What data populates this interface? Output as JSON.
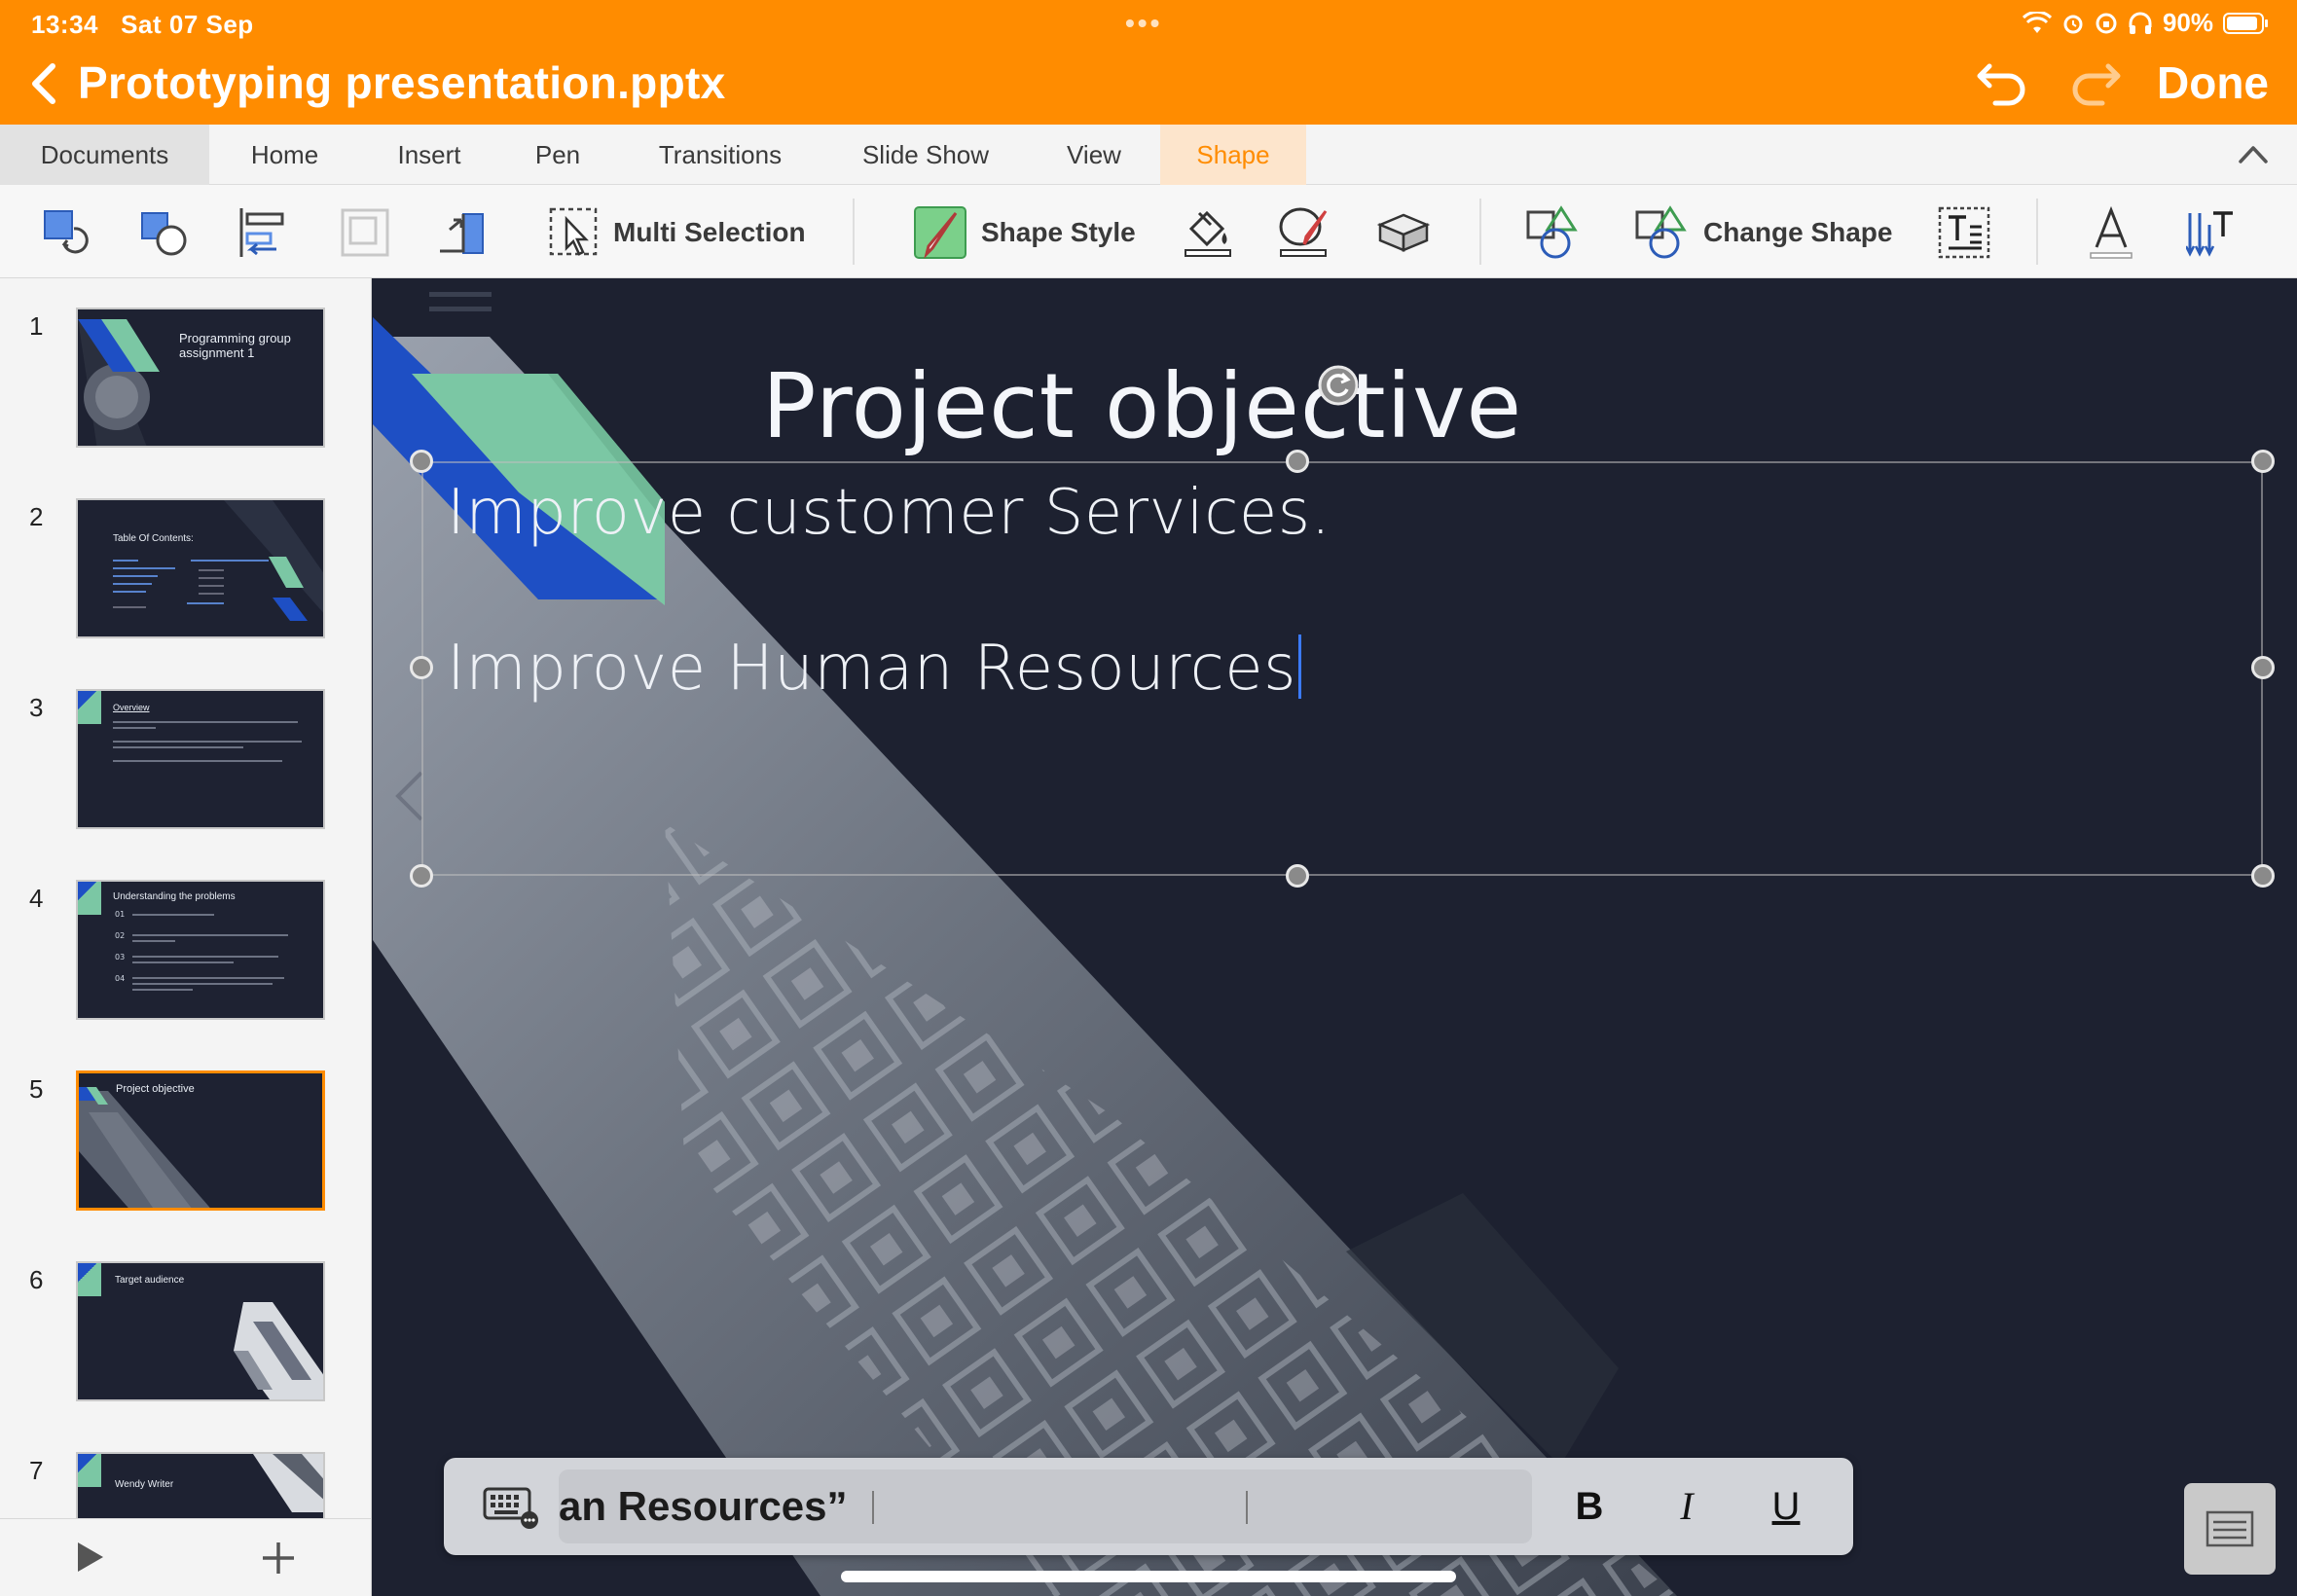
{
  "status": {
    "time": "13:34",
    "date": "Sat 07 Sep",
    "battery": "90%"
  },
  "titlebar": {
    "title": "Prototyping presentation.pptx",
    "done": "Done"
  },
  "tabs": [
    {
      "label": "Documents"
    },
    {
      "label": "Home"
    },
    {
      "label": "Insert"
    },
    {
      "label": "Pen"
    },
    {
      "label": "Transitions"
    },
    {
      "label": "Slide Show"
    },
    {
      "label": "View"
    },
    {
      "label": "Shape"
    }
  ],
  "active_tab": "Shape",
  "toolbar": {
    "multi_selection": "Multi Selection",
    "shape_style": "Shape Style",
    "change_shape": "Change Shape"
  },
  "slides": [
    {
      "num": "1",
      "title": "Programming group assignment 1"
    },
    {
      "num": "2",
      "title": "Table Of Contents:"
    },
    {
      "num": "3",
      "title": "Overview"
    },
    {
      "num": "4",
      "title": "Understanding the problems"
    },
    {
      "num": "5",
      "title": "Project objective",
      "active": true
    },
    {
      "num": "6",
      "title": "Target audience"
    },
    {
      "num": "7",
      "title": "Wendy Writer"
    }
  ],
  "slide": {
    "title": "Project objective",
    "bullets": [
      "Improve customer Services.",
      "Improve Human Resources"
    ]
  },
  "keyboard_bar": {
    "prediction": "an Resources”",
    "bold": "B",
    "italic": "I",
    "underline": "U"
  },
  "colors": {
    "accent": "#ff8c00",
    "slide_bg": "#1d2130",
    "stripe_blue": "#1e4fc4",
    "stripe_green": "#7bc7a4"
  }
}
